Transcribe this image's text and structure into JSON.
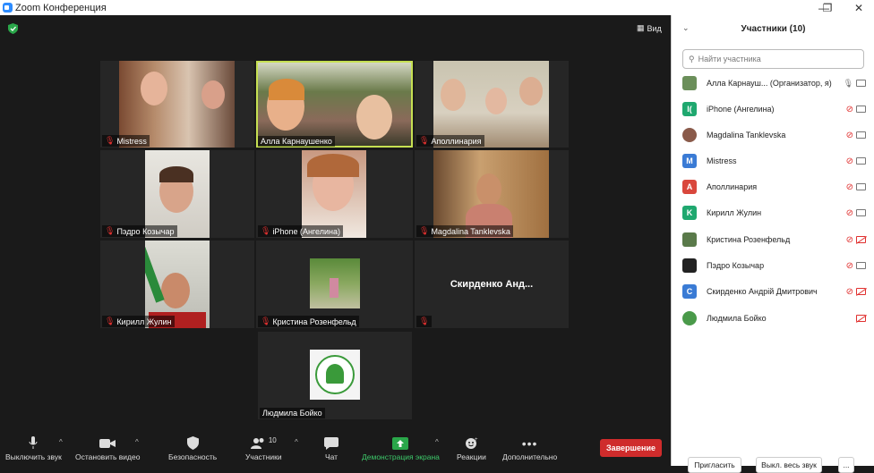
{
  "window": {
    "title": "Zoom Конференция"
  },
  "view_label": "Вид",
  "tiles": [
    {
      "name": "Mistress"
    },
    {
      "name": "Алла Карнаушенко"
    },
    {
      "name": "Аполлинария"
    },
    {
      "name": "Пэдро Козычар"
    },
    {
      "name": "iPhone (Ангелина)"
    },
    {
      "name": "Magdalina Tanklevska"
    },
    {
      "name": "Кирилл Жулин"
    },
    {
      "name": "Кристина Розенфельд"
    },
    {
      "name": "Скирденко  Анд..."
    },
    {
      "name": "Людмила Бойко"
    }
  ],
  "toolbar": {
    "mute": "Выключить звук",
    "video": "Остановить видео",
    "security": "Безопасность",
    "participants": "Участники",
    "participants_count": "10",
    "chat": "Чат",
    "share": "Демонстрация экрана",
    "reactions": "Реакции",
    "more": "Дополнительно",
    "end": "Завершение"
  },
  "panel": {
    "title": "Участники (10)",
    "search_placeholder": "Найти участника",
    "participants": [
      {
        "name": "Алла Карнауш... (Организатор, я)",
        "initial": "",
        "color": "#6b8f5a"
      },
      {
        "name": "iPhone (Ангелина)",
        "initial": "I(",
        "color": "#1fa86f"
      },
      {
        "name": "Magdalina Tanklevska",
        "initial": "",
        "color": "#8a5a4a"
      },
      {
        "name": "Mistress",
        "initial": "M",
        "color": "#3a7bd5"
      },
      {
        "name": "Аполлинария",
        "initial": "A",
        "color": "#d9473c"
      },
      {
        "name": "Кирилл Жулин",
        "initial": "K",
        "color": "#1fa86f"
      },
      {
        "name": "Кристина Розенфельд",
        "initial": "",
        "color": "#5a7a4a"
      },
      {
        "name": "Пэдро Козычар",
        "initial": "",
        "color": "#222222"
      },
      {
        "name": "Скирденко Андрій Дмитрович",
        "initial": "C",
        "color": "#3a7bd5"
      },
      {
        "name": "Людмила Бойко",
        "initial": "",
        "color": "#4a9a4a"
      }
    ],
    "invite": "Пригласить",
    "mute_all": "Выкл. весь звук",
    "more": "..."
  }
}
